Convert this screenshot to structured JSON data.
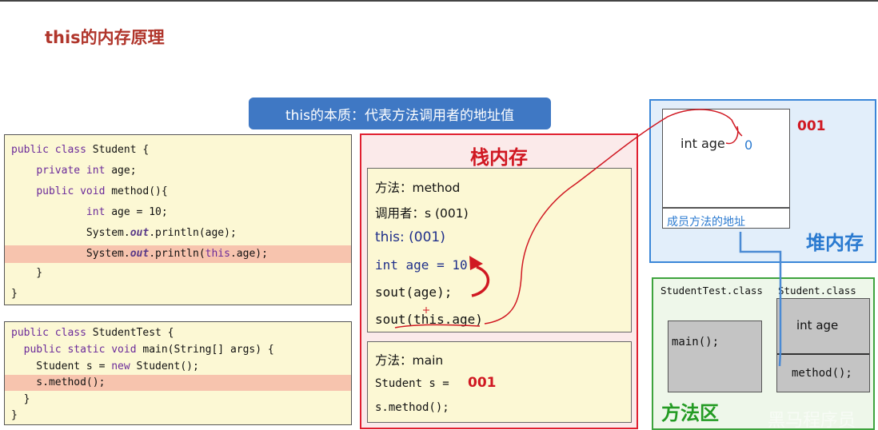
{
  "title": "this的内存原理",
  "essence_banner": "this的本质：代表方法调用者的地址值",
  "student_code": {
    "lines": [
      "public class Student {",
      "    private int age;",
      "    public void method(){",
      "            int age = 10;",
      "            System.out.println(age);",
      "            System.out.println(this.age);",
      "    }",
      "}"
    ],
    "highlighted_line": 5
  },
  "student_test_code": {
    "lines": [
      "public class StudentTest {",
      "  public static void main(String[] args) {",
      "    Student s = new Student();",
      "    s.method();",
      "  }",
      "}"
    ],
    "highlighted_line": 3
  },
  "stack": {
    "title": "栈内存",
    "method_frame": {
      "method_label": "方法：method",
      "caller_label": "调用者：s (001)",
      "this_label": "this: (001)",
      "local_var": "int age = 10",
      "sout_age": "sout(age);",
      "sout_this_age": "sout(this.age)"
    },
    "main_frame": {
      "method_label": "方法：main",
      "student_var": "Student s =",
      "student_addr": "001",
      "call": "s.method();"
    }
  },
  "heap": {
    "title": "堆内存",
    "address": "001",
    "field": "int age",
    "field_value": "0",
    "member_method_addr": "成员方法的地址"
  },
  "method_area": {
    "title": "方法区",
    "student_test_class": "StudentTest.class",
    "student_test_main": "main();",
    "student_class": "Student.class",
    "student_field": "int age",
    "student_method": "method();"
  },
  "watermark": "黑马程序员",
  "colors": {
    "title": "#b0352b",
    "stack_border": "#e02030",
    "heap_border": "#3a86d8",
    "method_area_border": "#3ea33e",
    "address_red": "#d01822",
    "keyword_purple": "#6b2a9a"
  }
}
